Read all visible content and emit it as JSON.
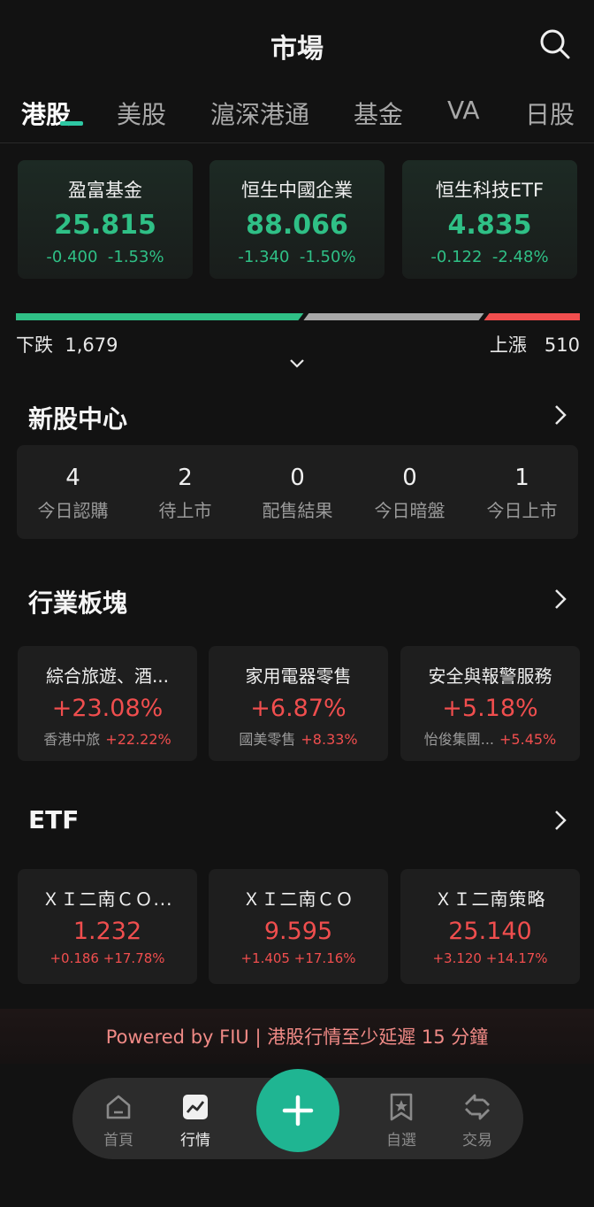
{
  "header": {
    "title": "市場"
  },
  "tabs": [
    "港股",
    "美股",
    "滬深港通",
    "基金",
    "VA",
    "日股"
  ],
  "indices": [
    {
      "name": "盈富基金",
      "price": "25.815",
      "change": "-0.400",
      "pct": "-1.53%"
    },
    {
      "name": "恒生中國企業",
      "price": "88.066",
      "change": "-1.340",
      "pct": "-1.50%"
    },
    {
      "name": "恒生科技ETF",
      "price": "4.835",
      "change": "-0.122",
      "pct": "-2.48%"
    }
  ],
  "breadth": {
    "down_label": "下跌",
    "down_count": "1,679",
    "up_label": "上漲",
    "up_count": "510",
    "down_fraction": 0.51,
    "flat_fraction": 0.32,
    "up_fraction": 0.17
  },
  "ipo": {
    "title": "新股中心",
    "items": [
      {
        "num": "4",
        "label": "今日認購"
      },
      {
        "num": "2",
        "label": "待上市"
      },
      {
        "num": "0",
        "label": "配售結果"
      },
      {
        "num": "0",
        "label": "今日暗盤"
      },
      {
        "num": "1",
        "label": "今日上市"
      }
    ]
  },
  "sectors": {
    "title": "行業板塊",
    "items": [
      {
        "name": "綜合旅遊、酒...",
        "pct": "+23.08%",
        "top_stock": "香港中旅",
        "top_pct": "+22.22%"
      },
      {
        "name": "家用電器零售",
        "pct": "+6.87%",
        "top_stock": "國美零售",
        "top_pct": "+8.33%"
      },
      {
        "name": "安全與報警服務",
        "pct": "+5.18%",
        "top_stock": "怡俊集團...",
        "top_pct": "+5.45%"
      }
    ]
  },
  "etf": {
    "title": "ETF",
    "items": [
      {
        "name": "ＸＩ二南ＣＯ...",
        "price": "1.232",
        "change": "+0.186",
        "pct": "+17.78%"
      },
      {
        "name": "ＸＩ二南ＣＯ",
        "price": "9.595",
        "change": "+1.405",
        "pct": "+17.16%"
      },
      {
        "name": "ＸＩ二南策略",
        "price": "25.140",
        "change": "+3.120",
        "pct": "+14.17%"
      }
    ]
  },
  "footer": {
    "text": "Powered by FIU | 港股行情至少延遲 15 分鐘"
  },
  "nav": [
    {
      "label": "首頁",
      "icon": "home-icon"
    },
    {
      "label": "行情",
      "icon": "chart-icon"
    },
    {
      "label": "自選",
      "icon": "bookmark-star-icon"
    },
    {
      "label": "交易",
      "icon": "exchange-icon"
    }
  ],
  "colors": {
    "up": "#f04e4e",
    "down": "#2fc086",
    "accent": "#1fb592",
    "background": "#121212"
  }
}
